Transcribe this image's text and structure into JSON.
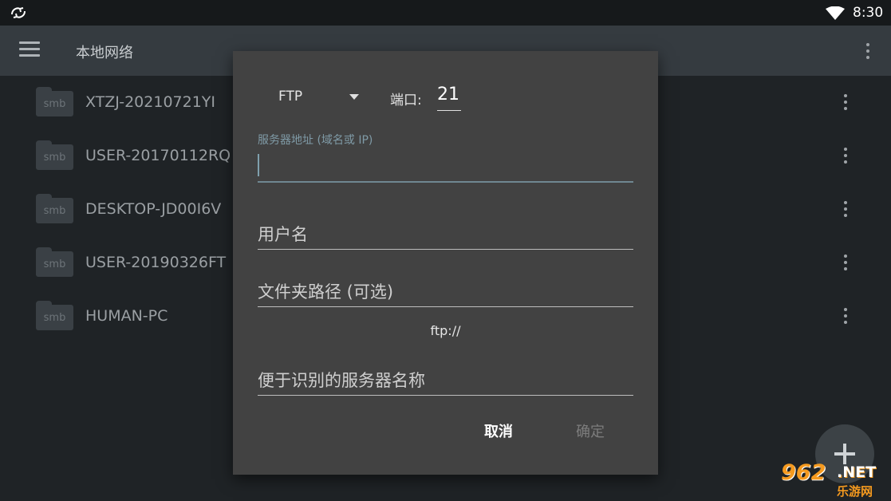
{
  "status_bar": {
    "time": "8:30",
    "app_icon": "sync-app-icon",
    "wifi_icon": "wifi-icon"
  },
  "app_bar": {
    "title": "本地网络",
    "menu_icon": "hamburger-menu-icon",
    "overflow_icon": "more-vert-icon"
  },
  "list": {
    "folder_badge": "smb",
    "items": [
      {
        "name": "XTZJ-20210721YI"
      },
      {
        "name": "USER-20170112RQ"
      },
      {
        "name": "DESKTOP-JD00I6V"
      },
      {
        "name": "USER-20190326FT"
      },
      {
        "name": "HUMAN-PC"
      }
    ]
  },
  "dialog": {
    "protocol": "FTP",
    "port_label": "端口:",
    "port_value": "21",
    "server_label": "服务器地址 (域名或 IP)",
    "server_value": "",
    "username_placeholder": "用户名",
    "path_placeholder": "文件夹路径 (可选)",
    "url_preview": "ftp://",
    "display_name_placeholder": "便于识别的服务器名称",
    "cancel_label": "取消",
    "ok_label": "确定"
  },
  "fab": {
    "icon": "plus-icon"
  },
  "watermark": {
    "number": "962",
    "suffix": ".NET",
    "chinese": "乐游网"
  },
  "colors": {
    "dialog_bg": "#424242",
    "accent": "#6f8791",
    "app_bar": "#353b40",
    "background": "#1f2326"
  }
}
